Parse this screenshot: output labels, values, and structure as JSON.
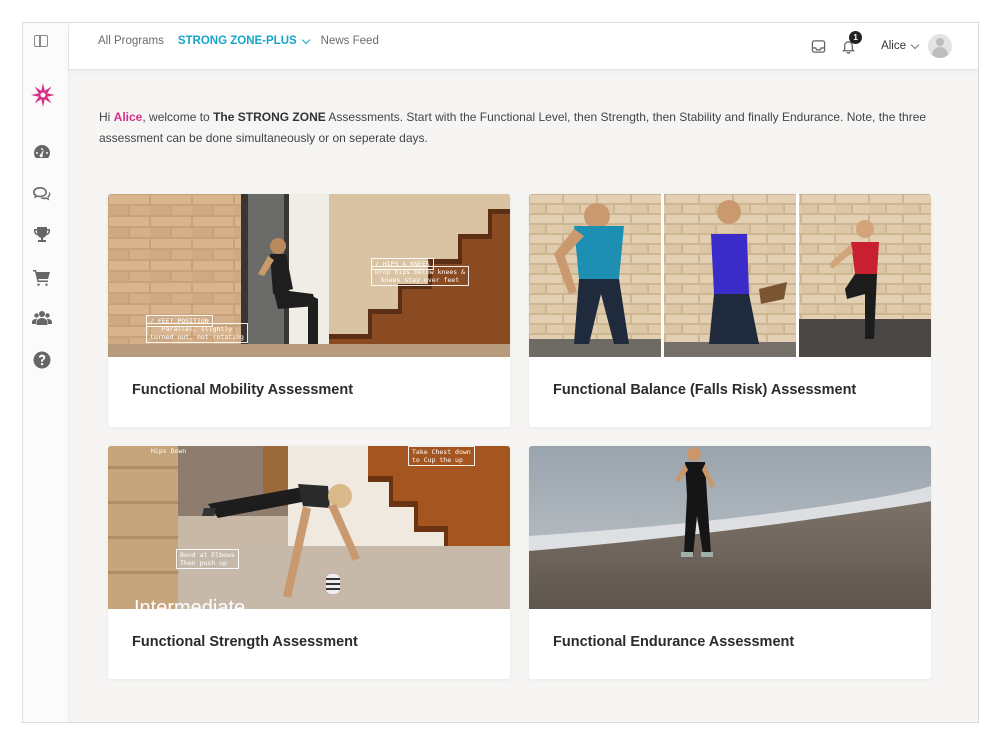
{
  "topbar": {
    "nav": {
      "all_programs": "All Programs",
      "active_program": "STRONG ZONE-PLUS",
      "news_feed": "News Feed"
    },
    "notification_count": "1",
    "user_name": "Alice"
  },
  "welcome": {
    "greeting": "Hi ",
    "name": "Alice",
    "part1": ", welcome to ",
    "brand": "The STRONG ZONE",
    "part2": " Assessments. Start with the Functional Level, then Strength, then Stability and finally Endurance. Note, the three assessment can be done simultaneously or on seperate days."
  },
  "cards": [
    {
      "title": "Functional Mobility Assessment",
      "annotations": [
        "/ HIPS & KNEES",
        "Drop hips below knees &",
        "knees stay over feet",
        "/ FEET POSITION",
        "Parallel, slightly",
        "turned out, not rotating"
      ]
    },
    {
      "title": "Functional Balance (Falls Risk) Assessment"
    },
    {
      "title": "Functional Strength Assessment",
      "annotations": [
        "Hips Down",
        "Take Chest down",
        "to Cup the up",
        "Bend at Elbows",
        "Then push up",
        "Intermediate"
      ]
    },
    {
      "title": "Functional Endurance Assessment"
    }
  ],
  "colors": {
    "accent": "#17a4c9",
    "name_highlight": "#d72f86",
    "logo": "#d72f86"
  },
  "icons": [
    "sidebar-toggle-icon",
    "starburst-logo",
    "dashboard-icon",
    "chat-icon",
    "trophy-icon",
    "cart-icon",
    "users-icon",
    "help-icon",
    "inbox-icon",
    "bell-icon",
    "chevron-down-icon"
  ]
}
